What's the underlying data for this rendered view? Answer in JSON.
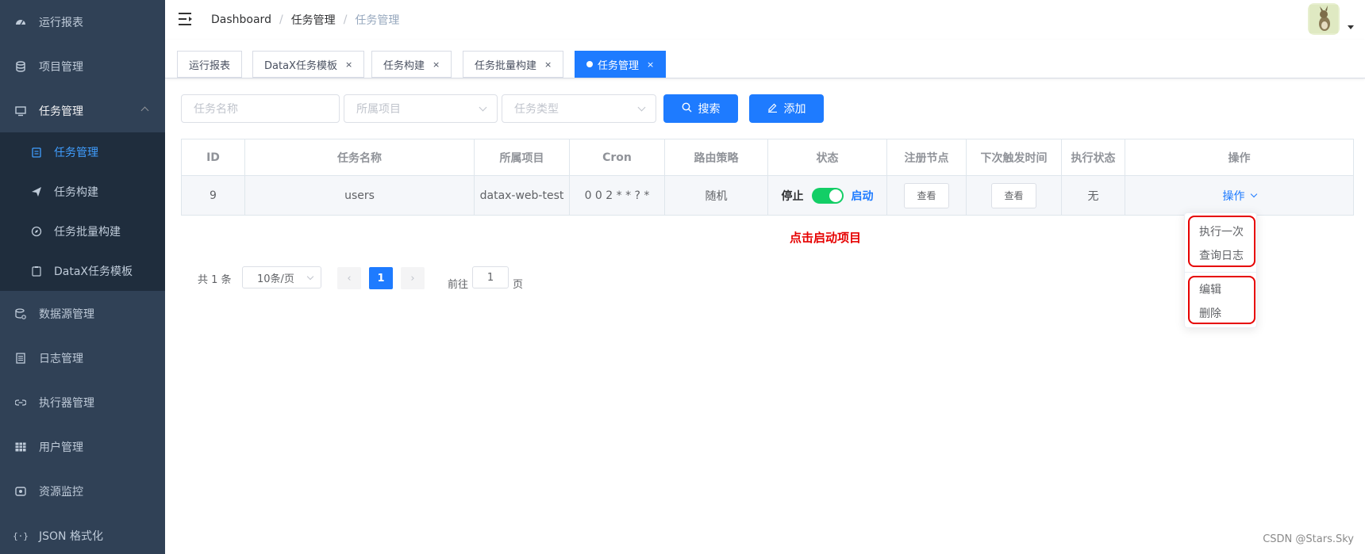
{
  "sidebar": {
    "items": [
      {
        "label": "运行报表",
        "icon": "dashboard-icon"
      },
      {
        "label": "项目管理",
        "icon": "database-icon"
      },
      {
        "label": "任务管理",
        "icon": "monitor-icon"
      },
      {
        "label": "数据源管理",
        "icon": "datasource-icon"
      },
      {
        "label": "日志管理",
        "icon": "document-icon"
      },
      {
        "label": "执行器管理",
        "icon": "link-icon"
      },
      {
        "label": "用户管理",
        "icon": "table-icon"
      },
      {
        "label": "资源监控",
        "icon": "monitor-eye-icon"
      },
      {
        "label": "JSON 格式化",
        "icon": "code-icon"
      }
    ],
    "submenu": [
      {
        "label": "任务管理",
        "icon": "calendar-icon",
        "active": true
      },
      {
        "label": "任务构建",
        "icon": "send-icon"
      },
      {
        "label": "任务批量构建",
        "icon": "compass-icon"
      },
      {
        "label": "DataX任务模板",
        "icon": "clipboard-icon"
      }
    ]
  },
  "breadcrumb": [
    "Dashboard",
    "任务管理",
    "任务管理"
  ],
  "tags": [
    {
      "label": "运行报表"
    },
    {
      "label": "DataX任务模板"
    },
    {
      "label": "任务构建"
    },
    {
      "label": "任务批量构建"
    },
    {
      "label": "任务管理",
      "active": true
    }
  ],
  "filters": {
    "task_name_placeholder": "任务名称",
    "project_placeholder": "所属项目",
    "task_type_placeholder": "任务类型",
    "search_label": "搜索",
    "add_label": "添加"
  },
  "table": {
    "headers": [
      "ID",
      "任务名称",
      "所属项目",
      "Cron",
      "路由策略",
      "状态",
      "注册节点",
      "下次触发时间",
      "执行状态",
      "操作"
    ],
    "rows": [
      {
        "id": "9",
        "name": "users",
        "project": "datax-web-test",
        "cron": "0 0 2 * * ? *",
        "route": "随机",
        "status_off": "停止",
        "status_on": "启动",
        "nodes_btn": "查看",
        "next_btn": "查看",
        "exec_status": "无",
        "op_label": "操作"
      }
    ]
  },
  "annotation": "点击启动项目",
  "dropdown": [
    "执行一次",
    "查询日志",
    "编辑",
    "删除"
  ],
  "pagination": {
    "total": "共 1 条",
    "page_size": "10条/页",
    "current": "1",
    "goto": "前往",
    "goto_value": "1",
    "page_unit": "页"
  },
  "watermark": "CSDN @Stars.Sky",
  "colors": {
    "sidebar": "#304156",
    "submenu": "#1f2d3d",
    "primary": "#1e7bff",
    "switch_on": "#13ce66",
    "annotation": "#e60000"
  }
}
